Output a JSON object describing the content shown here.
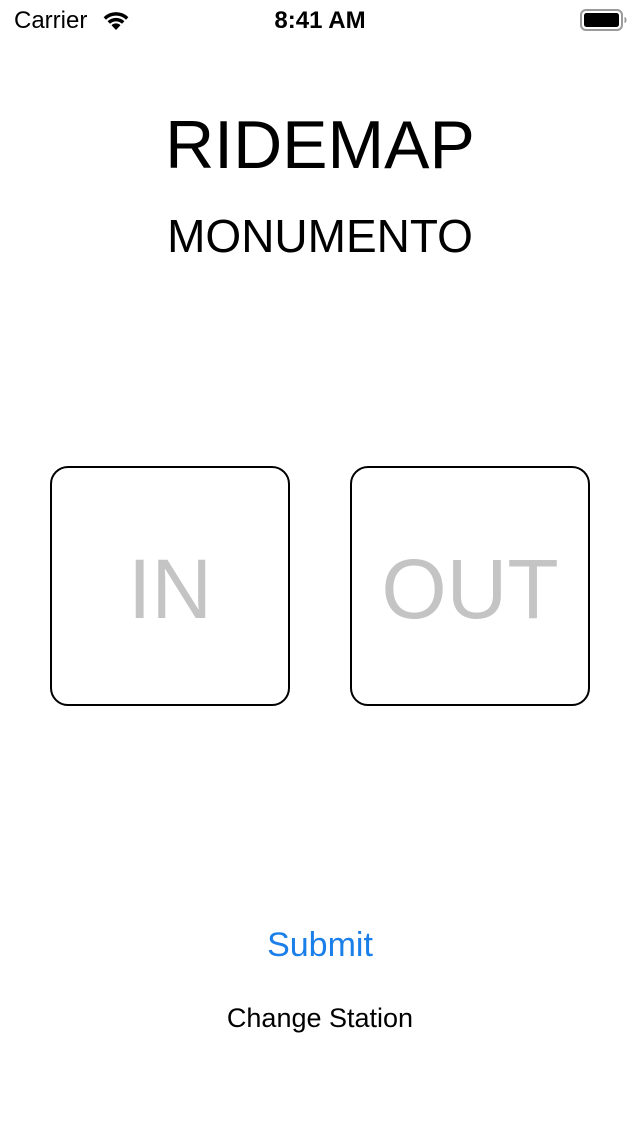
{
  "status_bar": {
    "carrier": "Carrier",
    "time": "8:41 AM",
    "wifi_icon": "wifi-icon",
    "battery_icon": "battery-icon",
    "battery_level": 1.0
  },
  "header": {
    "app_title": "RIDEMAP",
    "station_name": "MONUMENTO"
  },
  "direction": {
    "in_label": "IN",
    "out_label": "OUT"
  },
  "actions": {
    "submit_label": "Submit",
    "change_station_label": "Change Station"
  },
  "colors": {
    "background": "#ffffff",
    "text": "#000000",
    "tile_border": "#000000",
    "tile_label": "#c4c4c4",
    "accent": "#1a7fe8"
  }
}
